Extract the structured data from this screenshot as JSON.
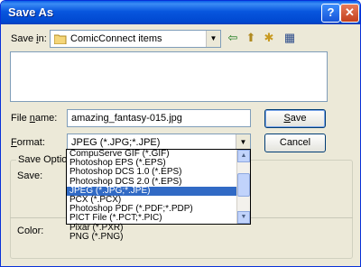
{
  "window": {
    "title": "Save As",
    "help_glyph": "?",
    "close_glyph": "✕"
  },
  "save_in": {
    "label_pre": "Save ",
    "label_key": "i",
    "label_post": "n:",
    "value": "ComicConnect items",
    "folder_icon": "folder-icon",
    "arrow": "▼"
  },
  "toolbar": {
    "back_glyph": "⇦",
    "up_glyph": "⬆",
    "new_folder_glyph": "✱",
    "view_glyph": "▦"
  },
  "file_name": {
    "label_pre": "File ",
    "label_key": "n",
    "label_post": "ame:",
    "value": "amazing_fantasy-015.jpg"
  },
  "format": {
    "label_key": "F",
    "label_post": "ormat:",
    "value": "JPEG (*.JPG;*.JPE)",
    "arrow": "▼",
    "options": [
      "CompuServe GIF (*.GIF)",
      "Photoshop EPS (*.EPS)",
      "Photoshop DCS 1.0 (*.EPS)",
      "Photoshop DCS 2.0 (*.EPS)",
      "JPEG (*.JPG;*.JPE)",
      "PCX (*.PCX)",
      "Photoshop PDF (*.PDF;*.PDP)",
      "PICT File (*.PCT;*.PIC)",
      "Pixar (*.PXR)",
      "PNG (*.PNG)"
    ],
    "selected_index": 4
  },
  "buttons": {
    "save_key": "S",
    "save_post": "ave",
    "cancel": "Cancel"
  },
  "save_options": {
    "legend": "Save Options",
    "save_label": "Save:",
    "color_label": "Color:"
  },
  "colors": {
    "title_bar": "#0054e3",
    "selection": "#316ac5",
    "dialog_bg": "#ece9d8"
  }
}
